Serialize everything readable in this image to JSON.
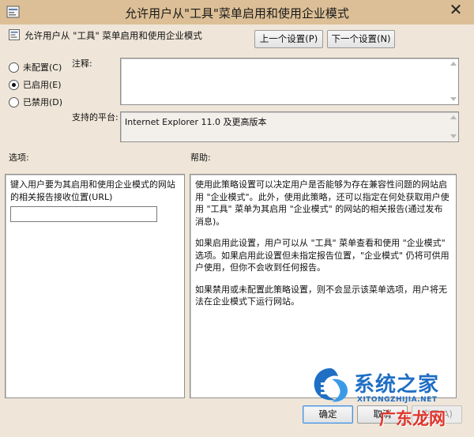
{
  "window": {
    "title": "允许用户从\"工具\"菜单启用和使用企业模式",
    "close_glyph": "✕"
  },
  "header": {
    "setting_name": "允许用户从 \"工具\" 菜单启用和使用企业模式",
    "prev_button": "上一个设置(P)",
    "next_button": "下一个设置(N)"
  },
  "state": {
    "options": [
      {
        "label": "未配置(C)",
        "checked": false
      },
      {
        "label": "已启用(E)",
        "checked": true
      },
      {
        "label": "已禁用(D)",
        "checked": false
      }
    ]
  },
  "comment": {
    "label": "注释:",
    "value": ""
  },
  "supported": {
    "label": "支持的平台:",
    "value": "Internet Explorer 11.0 及更高版本"
  },
  "options_panel": {
    "label": "选项:",
    "field_label": "键入用户要为其启用和使用企业模式的网站的相关报告接收位置(URL)",
    "field_value": ""
  },
  "help_panel": {
    "label": "帮助:",
    "paragraphs": [
      "使用此策略设置可以决定用户是否能够为存在兼容性问题的网站启用 \"企业模式\"。此外，使用此策略，还可以指定在何处获取用户使用 \"工具\" 菜单为其启用 \"企业模式\" 的网站的相关报告(通过发布消息)。",
      "如果启用此设置，用户可以从 \"工具\" 菜单查看和使用 \"企业模式\" 选项。如果启用此设置但未指定报告位置，\"企业模式\" 仍将可供用户使用，但你不会收到任何报告。",
      "如果禁用或未配置此策略设置，则不会显示该菜单选项，用户将无法在企业模式下运行网站。"
    ]
  },
  "footer": {
    "ok_button": "确定",
    "cancel_button": "取消",
    "apply_button": "应用(A)"
  },
  "watermark": {
    "brand_cn": "系统之家",
    "brand_en": "XITONGZHIJIA.NET",
    "site_cn": "广东龙网"
  },
  "colors": {
    "titlebar": "#dcbf96",
    "window_bg": "#efe6d9",
    "focus_border": "#4a8fd8",
    "watermark_blue": "#1f6fc5",
    "watermark_red": "#e0342a"
  }
}
